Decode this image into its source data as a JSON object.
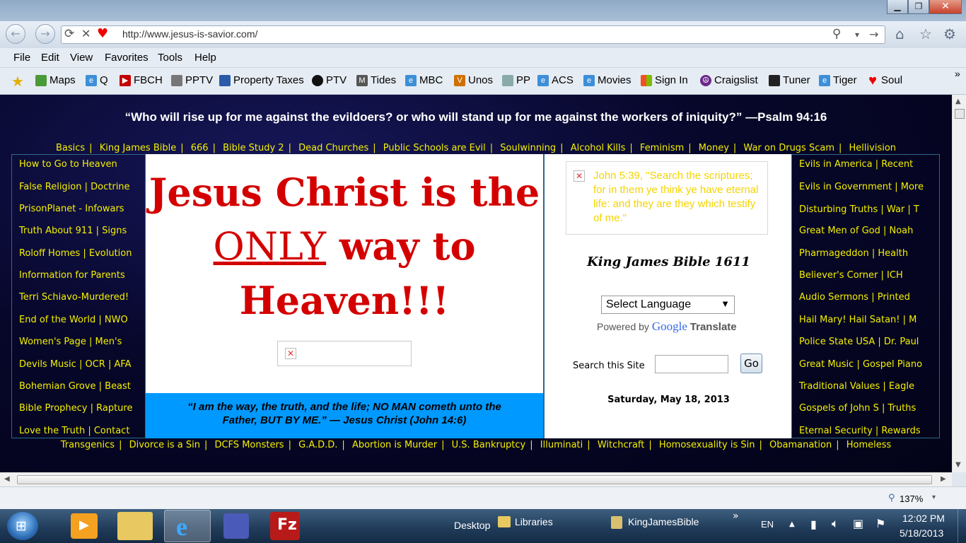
{
  "browser": {
    "url": "http://www.jesus-is-savior.com/",
    "menu": [
      "File",
      "Edit",
      "View",
      "Favorites",
      "Tools",
      "Help"
    ],
    "favorites": [
      "Maps",
      "Q",
      "FBCH",
      "PPTV",
      "Property Taxes",
      "PTV",
      "Tides",
      "MBC",
      "Unos",
      "PP",
      "ACS",
      "Movies",
      "Sign In",
      "Craigslist",
      "Tuner",
      "Tiger",
      "Soul"
    ],
    "more_chevron": "»",
    "zoom": "137%"
  },
  "page": {
    "top_quote": "“Who will rise up for me against the evildoers? or who will stand up for me against the workers of iniquity?” —Psalm 94:16",
    "top_links": [
      "Basics",
      "King James Bible",
      "666",
      "Bible Study 2",
      "Dead Churches",
      "Public Schools are Evil",
      "Soulwinning",
      "Alcohol Kills",
      "Feminism",
      "Money",
      "War on Drugs Scam",
      "Hellivision"
    ],
    "left_links": [
      "How to Go to Heaven",
      "False Religion | Doctrine",
      "PrisonPlanet - Infowars",
      "Truth About 911 | Signs",
      "Roloff Homes | Evolution",
      "Information for Parents",
      "Terri Schiavo-Murdered!",
      "End of the World | NWO",
      "Women's Page | Men's",
      "Devils Music | OCR | AFA",
      "Bohemian Grove | Beast",
      "Bible Prophecy | Rapture",
      "Love the Truth | Contact"
    ],
    "right_links": [
      "Evils in America | Recent",
      "Evils in Government | More",
      "Disturbing Truths | War | T",
      "Great Men of God | Noah",
      "Pharmageddon | Health",
      "Believer's Corner | ICH",
      "Audio Sermons | Printed",
      "Hail Mary! Hail Satan! | M",
      "Police State USA | Dr. Paul",
      "Great Music | Gospel Piano",
      "Traditional Values | Eagle",
      "Gospels of John S | Truths",
      "Eternal Security | Rewards"
    ],
    "headline_1": "Jesus Christ is the",
    "headline_only": "ONLY",
    "headline_2": " way to",
    "headline_3": "Heaven!!!",
    "blue_quote_1": "“I am the way, the truth, and the life; NO MAN cometh unto the",
    "blue_quote_2": "Father, BUT BY ME.” — Jesus Christ (John 14:6)",
    "verse": "John 5:39, \"Search the scriptures; for in them ye think ye have eternal life: and they are they which testify of me.\"",
    "kjv_title": "King James Bible 1611",
    "select_language": "Select Language",
    "powered_by": "Powered by",
    "google": "Google",
    "translate": "Translate",
    "search_label": "Search this Site",
    "go_label": "Go",
    "date": "Saturday, May 18, 2013",
    "bottom_links": [
      "Transgenics",
      "Divorce is a Sin",
      "DCFS Monsters",
      "G.A.D.D.",
      "Abortion is Murder",
      "U.S. Bankruptcy",
      "Illuminati",
      "Witchcraft",
      "Homosexuality is Sin",
      "Obamanation",
      "Homeless"
    ]
  },
  "taskbar": {
    "desktop": "Desktop",
    "libraries": "Libraries",
    "kjb": "KingJamesBible",
    "chevron": "»",
    "lang": "EN",
    "time": "12:02 PM",
    "date": "5/18/2013"
  },
  "colors": {
    "link": "#f4f000",
    "headline": "#d40000",
    "bluebar": "#0099ff"
  }
}
